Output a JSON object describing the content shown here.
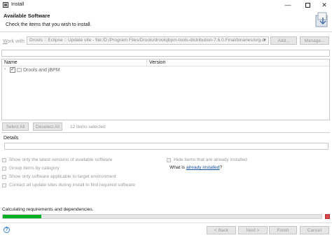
{
  "window": {
    "title": "Install"
  },
  "header": {
    "title": "Available Software",
    "description": "Check the items that you wish to install."
  },
  "work_with": {
    "label_prefix": "W",
    "label_rest": "ork with:",
    "value": "Drools :: Eclipse :: Update site - file:/D:/Program Files/Drools/droolsjbpm-tools-distribution-7.6.0.Final/binaries/org.d",
    "add_label": "Add...",
    "manage_label": "Manage..."
  },
  "tree": {
    "columns": [
      "Name",
      "Version"
    ],
    "items": [
      {
        "label": "Drools and jBPM",
        "version": "",
        "checked": true
      }
    ]
  },
  "selection": {
    "select_all": "Select All",
    "deselect_all": "Deselect All",
    "count_text": "12 items selected"
  },
  "details": {
    "label": "Details"
  },
  "options": {
    "latest": "Show only the latest versions of available software",
    "group": "Group items by category",
    "target": "Show only software applicable to target environment",
    "contact": "Contact all update sites during install to find required software",
    "hide": "Hide items that are already installed",
    "what_prefix": "What is ",
    "what_link": "already installed",
    "what_suffix": "?"
  },
  "status": {
    "text": "Calculating requirements and dependencies.",
    "progress": 0.12
  },
  "footer": {
    "help": "?",
    "back": "< Back",
    "next": "Next >",
    "finish": "Finish",
    "cancel": "Cancel"
  },
  "colors": {
    "progress": "#06b025",
    "link": "#1a4fa0"
  }
}
